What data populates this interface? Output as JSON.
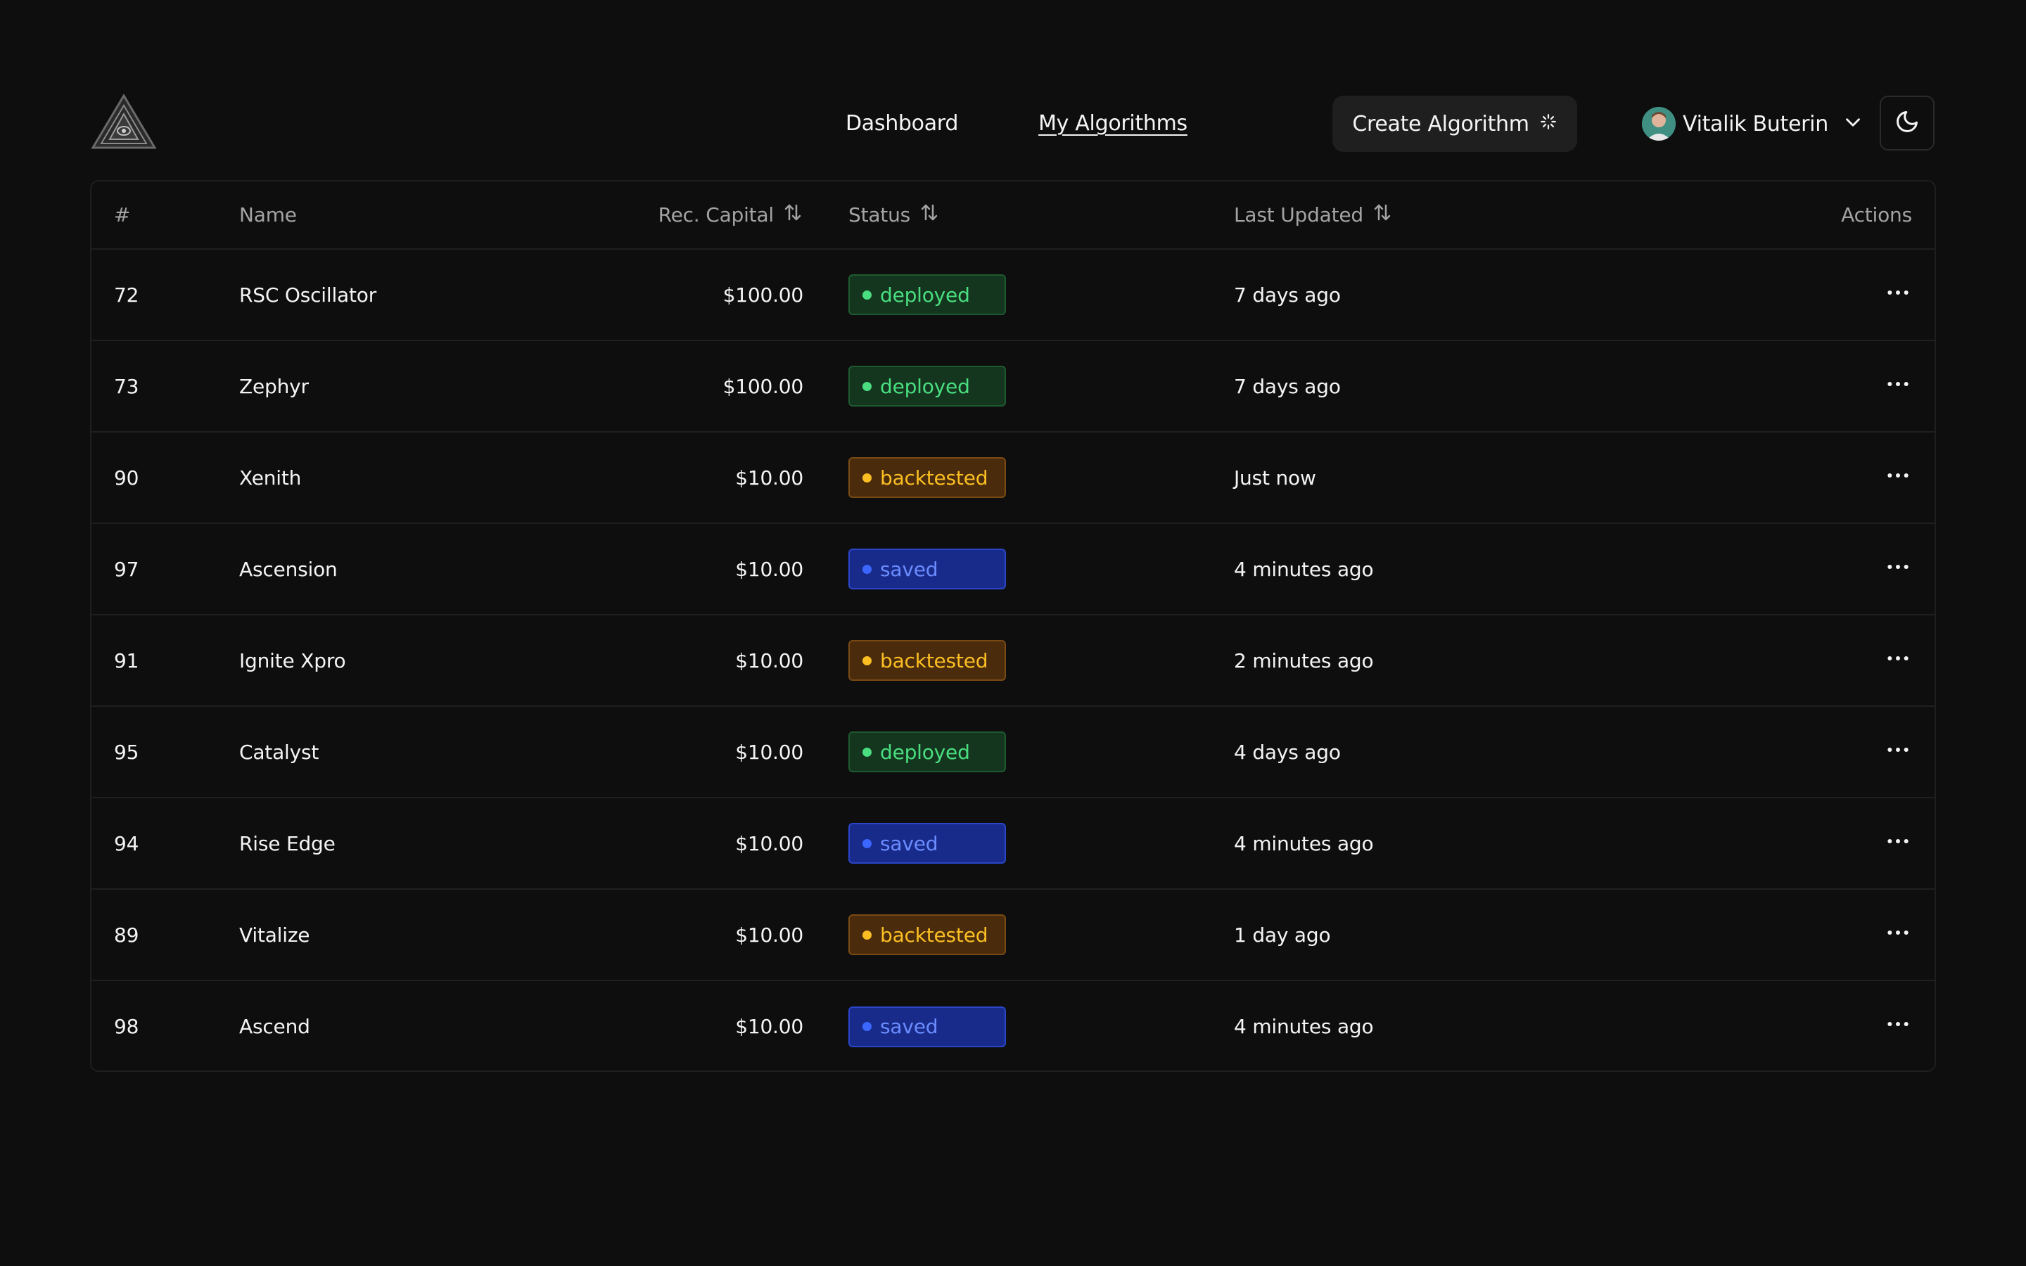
{
  "nav": {
    "items": [
      {
        "label": "Dashboard",
        "active": false
      },
      {
        "label": "My Algorithms",
        "active": true
      }
    ]
  },
  "create_button": {
    "label": "Create Algorithm",
    "icon": "sparkle-icon"
  },
  "user": {
    "name": "Vitalik Buterin",
    "icon": "chevron-down-icon"
  },
  "theme_toggle": {
    "icon": "moon-icon"
  },
  "table": {
    "headers": {
      "num": "#",
      "name": "Name",
      "capital": "Rec. Capital",
      "status": "Status",
      "updated": "Last Updated",
      "actions": "Actions"
    },
    "rows": [
      {
        "num": "72",
        "name": "RSC Oscillator",
        "capital": "$100.00",
        "status": "deployed",
        "updated": "7 days ago"
      },
      {
        "num": "73",
        "name": "Zephyr",
        "capital": "$100.00",
        "status": "deployed",
        "updated": "7 days ago"
      },
      {
        "num": "90",
        "name": "Xenith",
        "capital": "$10.00",
        "status": "backtested",
        "updated": "Just now"
      },
      {
        "num": "97",
        "name": "Ascension",
        "capital": "$10.00",
        "status": "saved",
        "updated": "4 minutes ago"
      },
      {
        "num": "91",
        "name": "Ignite Xpro",
        "capital": "$10.00",
        "status": "backtested",
        "updated": "2 minutes ago"
      },
      {
        "num": "95",
        "name": "Catalyst",
        "capital": "$10.00",
        "status": "deployed",
        "updated": "4 days ago"
      },
      {
        "num": "94",
        "name": "Rise Edge",
        "capital": "$10.00",
        "status": "saved",
        "updated": "4 minutes ago"
      },
      {
        "num": "89",
        "name": "Vitalize",
        "capital": "$10.00",
        "status": "backtested",
        "updated": "1 day ago"
      },
      {
        "num": "98",
        "name": "Ascend",
        "capital": "$10.00",
        "status": "saved",
        "updated": "4 minutes ago"
      }
    ]
  },
  "colors": {
    "background": "#0e0e0e",
    "deployed": "#4ade80",
    "backtested": "#fbbf24",
    "saved": "#6b8cff"
  }
}
